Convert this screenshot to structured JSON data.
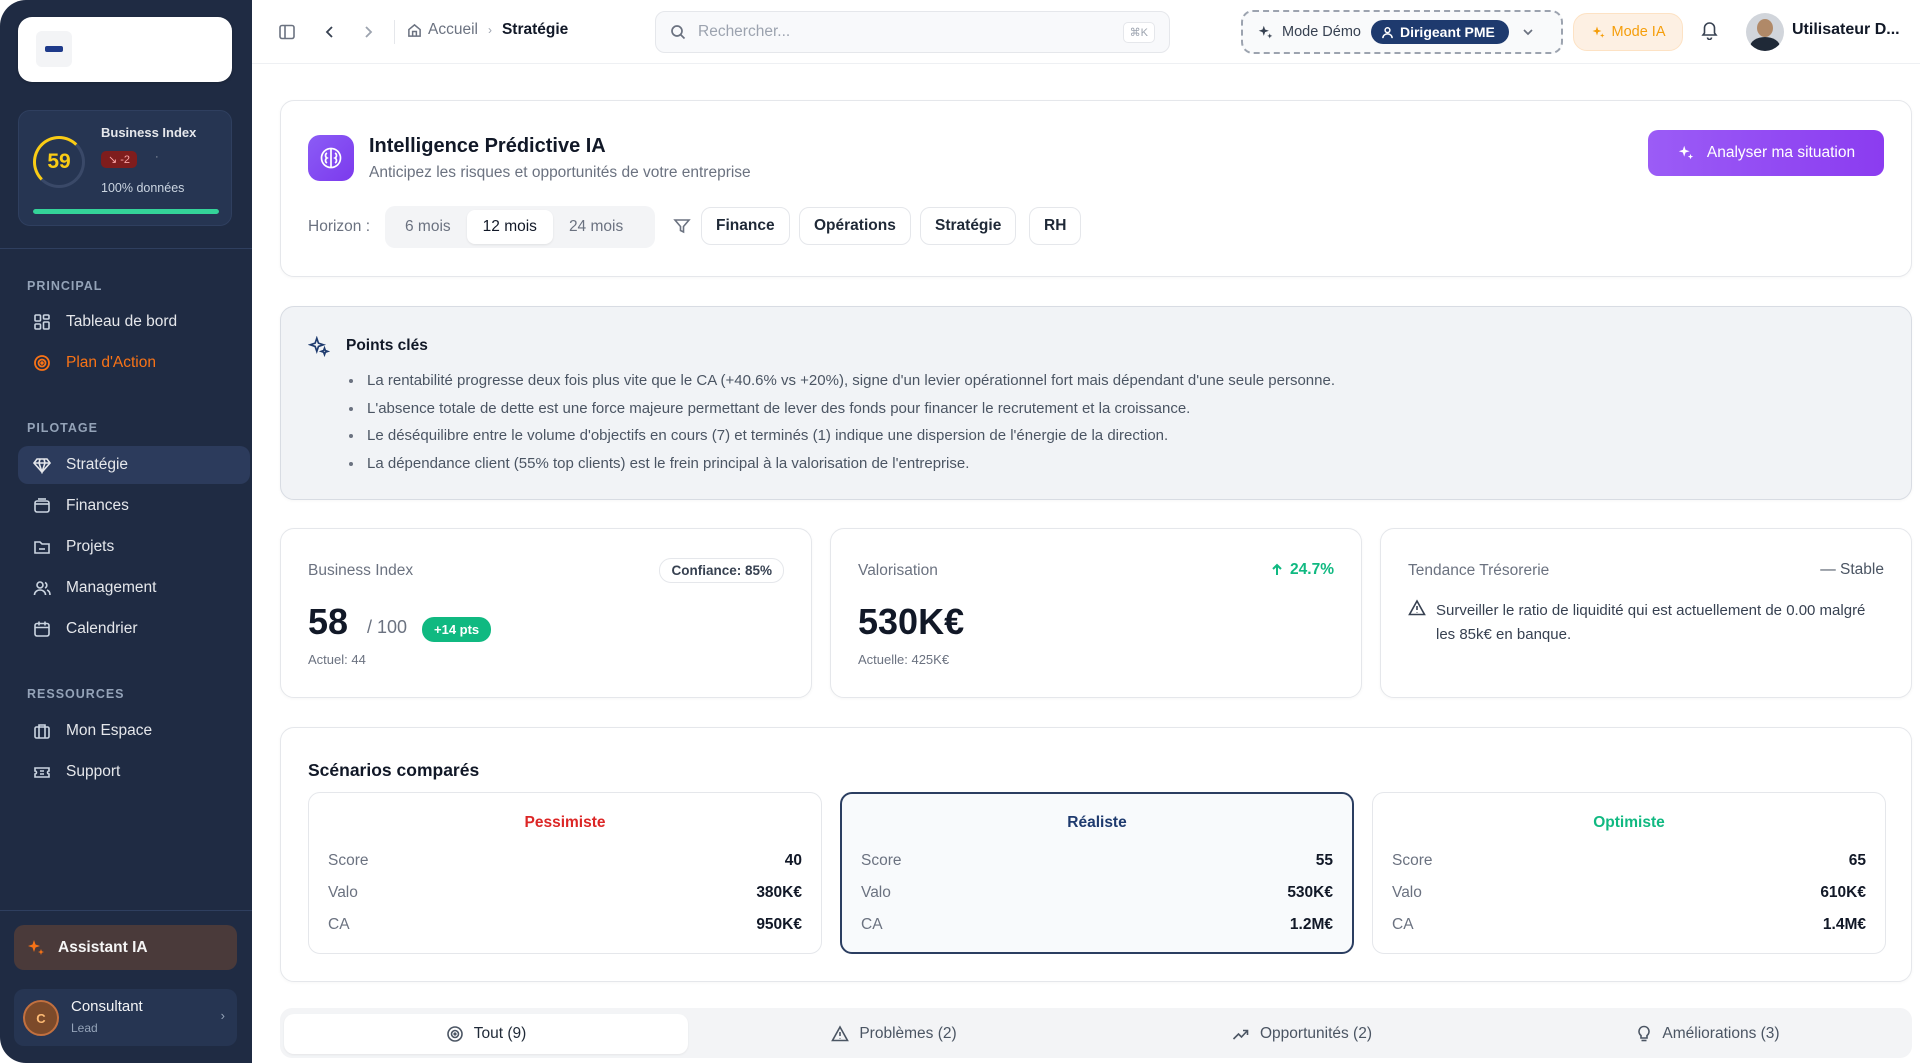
{
  "sidebar": {
    "business_index": {
      "title": "Business Index",
      "score": "59",
      "trend": "↘ -2",
      "dot": "·",
      "data": "100% données",
      "fill": 1.0
    },
    "sections": {
      "principal": "PRINCIPAL",
      "pilotage": "PILOTAGE",
      "ressources": "RESSOURCES"
    },
    "items": [
      {
        "label": "Tableau de bord",
        "icon": "dashboard-icon"
      },
      {
        "label": "Plan d'Action",
        "icon": "target-icon"
      },
      {
        "label": "Stratégie",
        "icon": "diamond-icon"
      },
      {
        "label": "Finances",
        "icon": "wallet-icon"
      },
      {
        "label": "Projets",
        "icon": "folder-icon"
      },
      {
        "label": "Management",
        "icon": "users-icon"
      },
      {
        "label": "Calendrier",
        "icon": "calendar-icon"
      },
      {
        "label": "Mon Espace",
        "icon": "briefcase-icon"
      },
      {
        "label": "Support",
        "icon": "ticket-icon"
      }
    ],
    "assistant": "Assistant IA",
    "user": {
      "initial": "C",
      "name": "Consultant",
      "role": "Lead"
    }
  },
  "topbar": {
    "breadcrumb": {
      "home": "Accueil",
      "current": "Stratégie"
    },
    "search": {
      "placeholder": "Rechercher...",
      "shortcut": "⌘K"
    },
    "demo_label": "Mode Démo",
    "role": "Dirigeant PME",
    "ia_mode": "Mode IA",
    "user_name": "Utilisateur D..."
  },
  "header": {
    "title": "Intelligence Prédictive IA",
    "subtitle": "Anticipez les risques et opportunités de votre entreprise",
    "analyze": "Analyser ma situation",
    "horizon_label": "Horizon :",
    "horizons": [
      "6 mois",
      "12 mois",
      "24 mois"
    ],
    "selected_horizon": "12 mois",
    "filters": [
      "Finance",
      "Opérations",
      "Stratégie",
      "RH"
    ]
  },
  "key_points": {
    "title": "Points clés",
    "items": [
      "La rentabilité progresse deux fois plus vite que le CA (+40.6% vs +20%), signe d'un levier opérationnel fort mais dépendant d'une seule personne.",
      "L'absence totale de dette est une force majeure permettant de lever des fonds pour financer le recrutement et la croissance.",
      "Le déséquilibre entre le volume d'objectifs en cours (7) et terminés (1) indique une dispersion de l'énergie de la direction.",
      "La dépendance client (55% top clients) est le frein principal à la valorisation de l'entreprise."
    ]
  },
  "kpis": {
    "business_index": {
      "label": "Business Index",
      "confidence": "Confiance: 85%",
      "value": "58",
      "unit": "/ 100",
      "badge": "+14 pts",
      "note": "Actuel: 44"
    },
    "valuation": {
      "label": "Valorisation",
      "delta": "24.7%",
      "value": "530K€",
      "note": "Actuelle: 425K€"
    },
    "treasury": {
      "label": "Tendance Trésorerie",
      "status": "— Stable",
      "warning": "Surveiller le ratio de liquidité qui est actuellement de 0.00 malgré les 85k€ en banque."
    }
  },
  "scenarios": {
    "title": "Scénarios comparés",
    "row_labels": {
      "score": "Score",
      "valo": "Valo",
      "ca": "CA"
    },
    "items": [
      {
        "name": "Pessimiste",
        "color": "#dc2626",
        "score": "40",
        "valo": "380K€",
        "ca": "950K€"
      },
      {
        "name": "Réaliste",
        "color": "#1e3a6e",
        "score": "55",
        "valo": "530K€",
        "ca": "1.2M€"
      },
      {
        "name": "Optimiste",
        "color": "#10b981",
        "score": "65",
        "valo": "610K€",
        "ca": "1.4M€"
      }
    ]
  },
  "tabs": [
    {
      "label": "Tout (9)",
      "icon": "target-icon"
    },
    {
      "label": "Problèmes (2)",
      "icon": "warning-icon"
    },
    {
      "label": "Opportunités (2)",
      "icon": "trending-up-icon"
    },
    {
      "label": "Améliorations (3)",
      "icon": "lightbulb-icon"
    }
  ],
  "colors": {
    "sidebar": "#1f2b43",
    "accent": "#8b5cf6",
    "success": "#10b981",
    "danger": "#dc2626",
    "warning": "#f59e0b"
  }
}
